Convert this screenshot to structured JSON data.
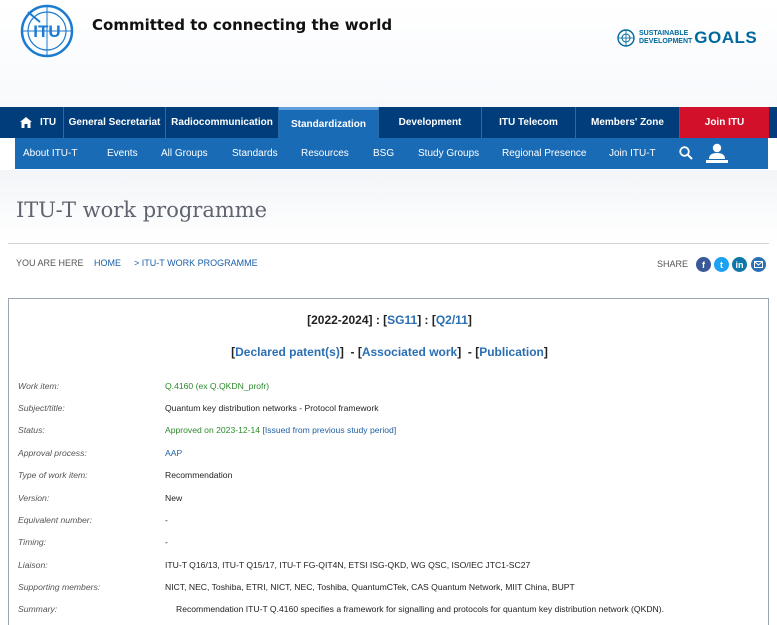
{
  "header": {
    "logo_text": "ITU",
    "tagline": "Committed to connecting the world",
    "sdg": {
      "line1": "SUSTAINABLE",
      "line2": "DEVELOPMENT",
      "goals": "GOALS"
    }
  },
  "nav_main": {
    "home": "ITU",
    "items": [
      "General Secretariat",
      "Radiocommunication",
      "Standardization",
      "Development",
      "ITU Telecom",
      "Members' Zone"
    ],
    "join": "Join ITU"
  },
  "nav_sub": {
    "items": [
      "About ITU-T",
      "Events",
      "All Groups",
      "Standards",
      "Resources",
      "BSG",
      "Study Groups",
      "Regional Presence",
      "Join ITU-T"
    ]
  },
  "page": {
    "title": "ITU-T work programme"
  },
  "breadcrumb": {
    "prefix": "YOU ARE HERE",
    "home": "HOME",
    "current": "> ITU-T WORK PROGRAMME",
    "share": "SHARE"
  },
  "heading": {
    "period": "2022-2024",
    "group": "SG11",
    "question": "Q2/11",
    "patents": "Declared patent(s)",
    "associated": "Associated work",
    "publication": "Publication"
  },
  "details": {
    "work_item": {
      "label": "Work item:",
      "value": "Q.4160 (ex Q.QKDN_profr)"
    },
    "subject": {
      "label": "Subject/title:",
      "value": "Quantum key distribution networks - Protocol framework"
    },
    "status": {
      "label": "Status:",
      "value": "Approved on 2023-12-14",
      "link": "[Issued from previous study period]"
    },
    "approval": {
      "label": "Approval process:",
      "value": "AAP"
    },
    "type": {
      "label": "Type of work item:",
      "value": "Recommendation"
    },
    "version": {
      "label": "Version:",
      "value": "New"
    },
    "equivalent": {
      "label": "Equivalent number:",
      "value": "-"
    },
    "timing": {
      "label": "Timing:",
      "value": "-"
    },
    "liaison": {
      "label": "Liaison:",
      "value": "ITU-T Q16/13, ITU-T Q15/17, ITU-T FG-QIT4N, ETSI ISG-QKD, WG QSC, ISO/IEC JTC1-SC27"
    },
    "supporting": {
      "label": "Supporting members:",
      "value": "NICT, NEC, Toshiba, ETRI, NICT, NEC, Toshiba, QuantumCTek, CAS Quantum Network, MIIT China, BUPT"
    },
    "summary": {
      "label": "Summary:",
      "value": "Recommendation ITU-T Q.4160 specifies a framework for signalling and protocols for quantum key distribution network (QKDN)."
    }
  },
  "colors": {
    "nav_dark": "#003d7a",
    "nav_blue": "#1a6bb5",
    "join_red": "#d3102a",
    "link": "#2a6fb3",
    "approved_green": "#2c8a2c"
  }
}
